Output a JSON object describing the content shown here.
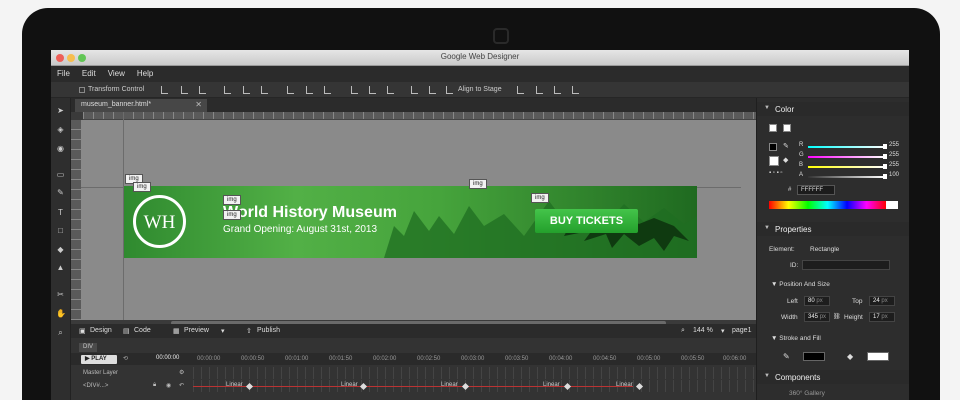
{
  "window": {
    "title": "Google Web Designer"
  },
  "menu": [
    "File",
    "Edit",
    "View",
    "Help"
  ],
  "toolbar": {
    "transform_control": "Transform Control",
    "align_to_stage": "Align to Stage"
  },
  "document": {
    "tab": "museum_banner.html*"
  },
  "banner": {
    "logo_text": "WH",
    "title": "World History Museum",
    "subtitle": "Grand Opening: August 31st, 2013",
    "cta": "BUY TICKETS",
    "colors": {
      "banner": "#46a43c",
      "button": "#2fb036"
    }
  },
  "stage_tags": [
    "img",
    "img",
    "img",
    "img",
    "img",
    "img"
  ],
  "modes": {
    "design": "Design",
    "code": "Code",
    "preview": "Preview",
    "publish": "Publish",
    "zoom": "144",
    "zoom_unit": "%",
    "page": "page1"
  },
  "timeline": {
    "breadcrumb": "DIV",
    "play": "PLAY",
    "time": "00:00:00",
    "marks": [
      "00:00:00",
      "00:00:50",
      "00:01:00",
      "00:01:50",
      "00:02:00",
      "00:02:50",
      "00:03:00",
      "00:03:50",
      "00:04:00",
      "00:04:50",
      "00:05:00",
      "00:05:50",
      "00:06:00"
    ],
    "master_layer": "Master Layer",
    "row_name": "<DIV#...>",
    "easing": "Linear"
  },
  "color_panel": {
    "title": "Color",
    "channels": [
      {
        "name": "R",
        "value": "255"
      },
      {
        "name": "G",
        "value": "255"
      },
      {
        "name": "B",
        "value": "255"
      },
      {
        "name": "A",
        "value": "100"
      }
    ],
    "hex_label": "#",
    "hex": "FFFFFF"
  },
  "properties": {
    "title": "Properties",
    "element_label": "Element:",
    "element": "Rectangle",
    "id_label": "ID:",
    "position_title": "Position And Size",
    "left_label": "Left",
    "left": "80",
    "top_label": "Top",
    "top": "24",
    "width_label": "Width",
    "width": "345",
    "height_label": "Height",
    "height": "17",
    "unit": "px",
    "stroke_title": "Stroke and Fill"
  },
  "components": {
    "title": "Components",
    "item": "360° Gallery"
  }
}
